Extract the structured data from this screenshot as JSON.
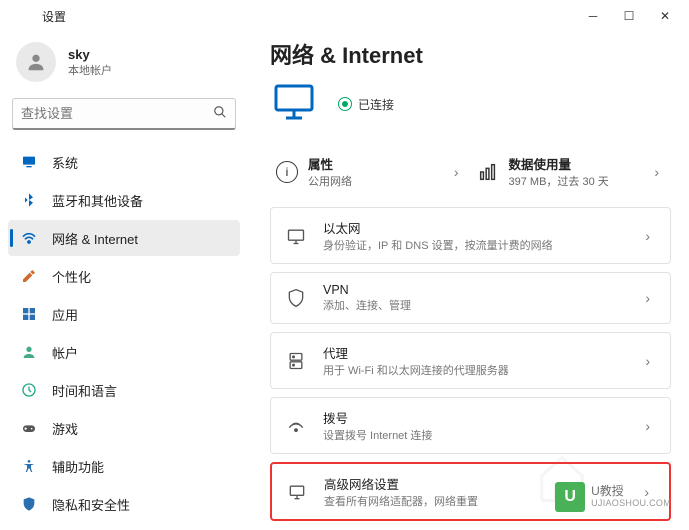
{
  "window": {
    "title": "设置"
  },
  "user": {
    "name": "sky",
    "subtitle": "本地帐户"
  },
  "search": {
    "placeholder": "查找设置"
  },
  "nav": [
    {
      "icon": "system",
      "label": "系统",
      "color": "#0067c0"
    },
    {
      "icon": "bluetooth",
      "label": "蓝牙和其他设备",
      "color": "#0067c0"
    },
    {
      "icon": "network",
      "label": "网络 & Internet",
      "color": "#0067c0",
      "active": true
    },
    {
      "icon": "personalize",
      "label": "个性化",
      "color": "#d06a2e"
    },
    {
      "icon": "apps",
      "label": "应用",
      "color": "#2a6fb0"
    },
    {
      "icon": "accounts",
      "label": "帐户",
      "color": "#4a8"
    },
    {
      "icon": "time",
      "label": "时间和语言",
      "color": "#2a8"
    },
    {
      "icon": "gaming",
      "label": "游戏",
      "color": "#555"
    },
    {
      "icon": "accessibility",
      "label": "辅助功能",
      "color": "#2a6fb0"
    },
    {
      "icon": "privacy",
      "label": "隐私和安全性",
      "color": "#2a6fb0"
    }
  ],
  "page": {
    "title": "网络 & Internet",
    "status": "已连接",
    "tiles": {
      "props": {
        "title": "属性",
        "sub": "公用网络"
      },
      "usage": {
        "title": "数据使用量",
        "sub": "397 MB，过去 30 天"
      }
    },
    "items": [
      {
        "key": "ethernet",
        "title": "以太网",
        "sub": "身份验证，IP 和 DNS 设置，按流量计费的网络"
      },
      {
        "key": "vpn",
        "title": "VPN",
        "sub": "添加、连接、管理"
      },
      {
        "key": "proxy",
        "title": "代理",
        "sub": "用于 Wi-Fi 和以太网连接的代理服务器"
      },
      {
        "key": "dialup",
        "title": "拨号",
        "sub": "设置拨号 Internet 连接"
      },
      {
        "key": "advanced",
        "title": "高级网络设置",
        "sub": "查看所有网络适配器，网络重置",
        "highlight": true
      }
    ]
  },
  "watermark": {
    "brand": "U教授",
    "url": "UJIAOSHOU.COM"
  }
}
